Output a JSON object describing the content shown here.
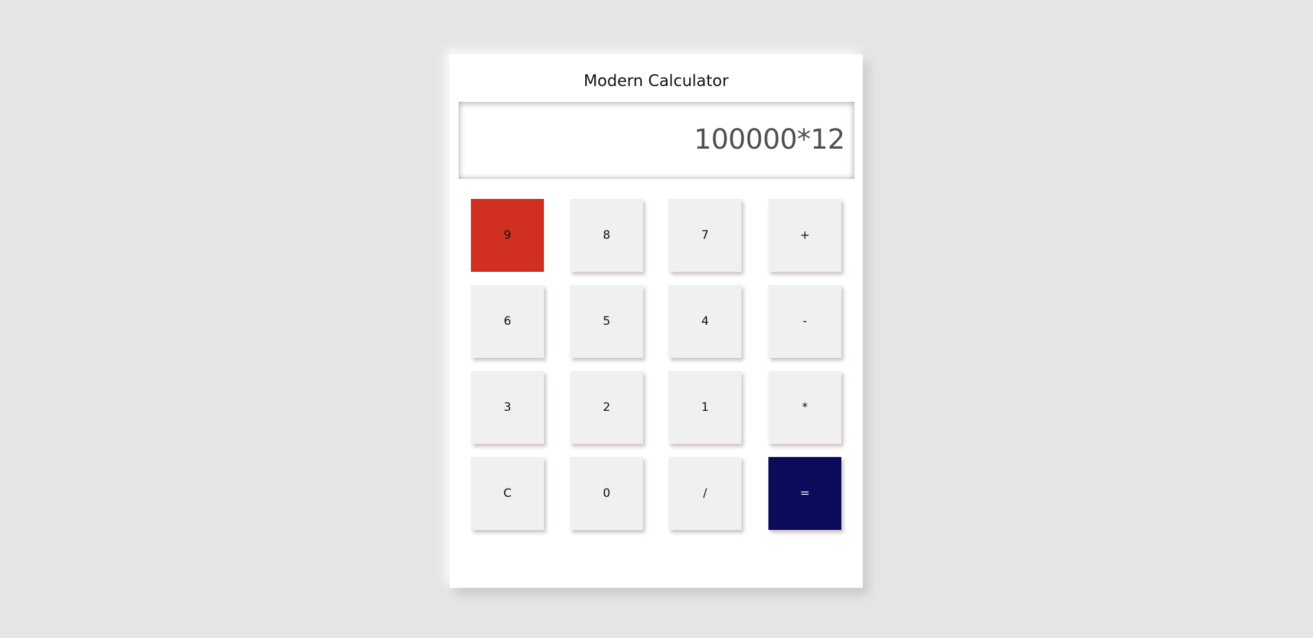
{
  "calculator": {
    "title": "Modern Calculator",
    "display": "100000*12",
    "keys": [
      {
        "label": "9"
      },
      {
        "label": "8"
      },
      {
        "label": "7"
      },
      {
        "label": "+"
      },
      {
        "label": "6"
      },
      {
        "label": "5"
      },
      {
        "label": "4"
      },
      {
        "label": "-"
      },
      {
        "label": "3"
      },
      {
        "label": "2"
      },
      {
        "label": "1"
      },
      {
        "label": "*"
      },
      {
        "label": "C"
      },
      {
        "label": "0"
      },
      {
        "label": "/"
      },
      {
        "label": "="
      }
    ]
  },
  "colors": {
    "background": "#e6e5e4",
    "key": "#f0f0f0",
    "pressed_key": "#d02f21",
    "equals_key": "#0b0b5c"
  }
}
